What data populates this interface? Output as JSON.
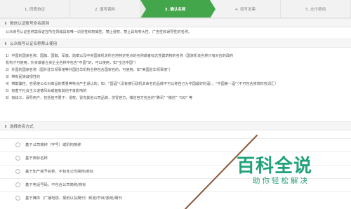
{
  "steps": [
    {
      "label": "1. 同意协议"
    },
    {
      "label": "2. 填写资料"
    },
    {
      "label": "3. 确认名称"
    },
    {
      "label": "4. 填写发票"
    },
    {
      "label": "5. 支付费用"
    }
  ],
  "section1": {
    "title": "微信认证账号命名原则",
    "text": "公众账号认证名称需保证在所在领域具有唯一识别性和权威性，禁止侵权，禁止具有夸大性、广告性和误导性的名称。"
  },
  "section2": {
    "title": "公众账号认证名称禁止使用",
    "rules": [
      "1）中国的国家名称、国旗、国徽、军旗、勋章以及中央国家机关所在地特定地点的名称或者标志性建筑物的名称（国家机关名称只有对应的政府",
      "机构才可使用，外资或者合资企业名称中包含“中国”的，可以使用，如“宝洁中国”）",
      "2）外国的国家名称（国外驻华领事馆等外国驻华机构全称包含国家名的，可使用，如“美国驻华领事馆”）",
      "3）带有民族歧视性的",
      "4）带欺骗性、容易使公众对商品的质量等特点产生误认的；如：“国酒”（没有被行政机关命名的品牌不可以称自己为中国最好的酒），“中国第一酒”（不可包含修饰形容词汇）",
      "5）有害于社会主义道德风尚或者有其他不良影响的",
      "6）有歧义，误导用户，包括但不限于：侵权，冒充其他公司品牌，仿冒官方，微信官方包含的“腾讯” “微信” “QQ” 等"
    ]
  },
  "section3": {
    "title": "选择命名方式",
    "options": [
      "基于公司简称（字号）或机构简称",
      "基于商标名称",
      "基于知产授予名称，不包含公司简称/商标",
      "基于电话号码，不包含公司简称/商标",
      "基于媒体（广播电视、报纸以及期刊）频道/节目/报纸/期刊"
    ]
  },
  "watermark": {
    "title": "百科全说",
    "subtitle": "助你轻松解决"
  },
  "colors": {
    "accent": "#44a64a",
    "watermark": "#1fa17a",
    "annotation": "#8a5a3a"
  }
}
